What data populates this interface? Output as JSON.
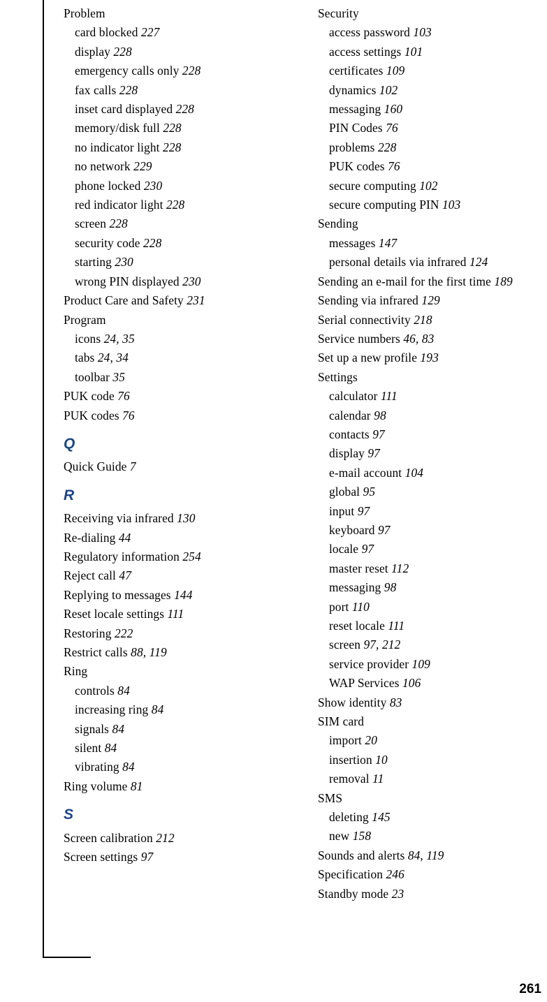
{
  "page": {
    "folio": "261",
    "rule_color": "#000000",
    "section_letter_color": "#1c4587"
  },
  "columns": {
    "left": [
      {
        "kind": "entry",
        "level": 1,
        "text": "Problem",
        "pages": ""
      },
      {
        "kind": "entry",
        "level": 2,
        "text": "card blocked",
        "pages": "227"
      },
      {
        "kind": "entry",
        "level": 2,
        "text": "display",
        "pages": "228"
      },
      {
        "kind": "entry",
        "level": 2,
        "text": "emergency calls only",
        "pages": "228"
      },
      {
        "kind": "entry",
        "level": 2,
        "text": "fax calls",
        "pages": "228"
      },
      {
        "kind": "entry",
        "level": 2,
        "text": "inset card displayed",
        "pages": "228"
      },
      {
        "kind": "entry",
        "level": 2,
        "text": "memory/disk full",
        "pages": "228"
      },
      {
        "kind": "entry",
        "level": 2,
        "text": "no indicator light",
        "pages": "228"
      },
      {
        "kind": "entry",
        "level": 2,
        "text": "no network",
        "pages": "229"
      },
      {
        "kind": "entry",
        "level": 2,
        "text": "phone locked",
        "pages": "230"
      },
      {
        "kind": "entry",
        "level": 2,
        "text": "red indicator light",
        "pages": "228"
      },
      {
        "kind": "entry",
        "level": 2,
        "text": "screen",
        "pages": "228"
      },
      {
        "kind": "entry",
        "level": 2,
        "text": "security code",
        "pages": "228"
      },
      {
        "kind": "entry",
        "level": 2,
        "text": "starting",
        "pages": "230"
      },
      {
        "kind": "entry",
        "level": 2,
        "text": "wrong PIN displayed",
        "pages": "230"
      },
      {
        "kind": "entry",
        "level": 1,
        "text": "Product Care and Safety",
        "pages": "231"
      },
      {
        "kind": "entry",
        "level": 1,
        "text": "Program",
        "pages": ""
      },
      {
        "kind": "entry",
        "level": 2,
        "text": "icons",
        "pages": "24, 35"
      },
      {
        "kind": "entry",
        "level": 2,
        "text": "tabs",
        "pages": "24, 34"
      },
      {
        "kind": "entry",
        "level": 2,
        "text": "toolbar",
        "pages": "35"
      },
      {
        "kind": "entry",
        "level": 1,
        "text": "PUK code",
        "pages": "76"
      },
      {
        "kind": "entry",
        "level": 1,
        "text": "PUK codes",
        "pages": "76"
      },
      {
        "kind": "letter",
        "letter": "Q"
      },
      {
        "kind": "entry",
        "level": 1,
        "text": "Quick Guide",
        "pages": "7"
      },
      {
        "kind": "letter",
        "letter": "R"
      },
      {
        "kind": "entry",
        "level": 1,
        "text": "Receiving via infrared",
        "pages": "130"
      },
      {
        "kind": "entry",
        "level": 1,
        "text": "Re-dialing",
        "pages": "44"
      },
      {
        "kind": "entry",
        "level": 1,
        "text": "Regulatory information",
        "pages": "254"
      },
      {
        "kind": "entry",
        "level": 1,
        "text": "Reject call",
        "pages": "47"
      },
      {
        "kind": "entry",
        "level": 1,
        "text": "Replying to messages",
        "pages": "144"
      },
      {
        "kind": "entry",
        "level": 1,
        "text": "Reset locale settings",
        "pages": "111"
      },
      {
        "kind": "entry",
        "level": 1,
        "text": "Restoring",
        "pages": "222"
      },
      {
        "kind": "entry",
        "level": 1,
        "text": "Restrict calls",
        "pages": "88, 119"
      },
      {
        "kind": "entry",
        "level": 1,
        "text": "Ring",
        "pages": ""
      },
      {
        "kind": "entry",
        "level": 2,
        "text": "controls",
        "pages": "84"
      },
      {
        "kind": "entry",
        "level": 2,
        "text": "increasing ring",
        "pages": "84"
      },
      {
        "kind": "entry",
        "level": 2,
        "text": "signals",
        "pages": "84"
      },
      {
        "kind": "entry",
        "level": 2,
        "text": "silent",
        "pages": "84"
      },
      {
        "kind": "entry",
        "level": 2,
        "text": "vibrating",
        "pages": "84"
      },
      {
        "kind": "entry",
        "level": 1,
        "text": "Ring volume",
        "pages": "81"
      },
      {
        "kind": "letter",
        "letter": "S"
      },
      {
        "kind": "entry",
        "level": 1,
        "text": "Screen calibration",
        "pages": "212"
      },
      {
        "kind": "entry",
        "level": 1,
        "text": "Screen settings",
        "pages": "97"
      }
    ],
    "right": [
      {
        "kind": "entry",
        "level": 1,
        "text": "Security",
        "pages": ""
      },
      {
        "kind": "entry",
        "level": 2,
        "text": "access password",
        "pages": "103"
      },
      {
        "kind": "entry",
        "level": 2,
        "text": "access settings",
        "pages": "101"
      },
      {
        "kind": "entry",
        "level": 2,
        "text": "certificates",
        "pages": "109"
      },
      {
        "kind": "entry",
        "level": 2,
        "text": "dynamics",
        "pages": "102"
      },
      {
        "kind": "entry",
        "level": 2,
        "text": "messaging",
        "pages": "160"
      },
      {
        "kind": "entry",
        "level": 2,
        "text": "PIN Codes",
        "pages": "76"
      },
      {
        "kind": "entry",
        "level": 2,
        "text": "problems",
        "pages": "228"
      },
      {
        "kind": "entry",
        "level": 2,
        "text": "PUK codes",
        "pages": "76"
      },
      {
        "kind": "entry",
        "level": 2,
        "text": "secure computing",
        "pages": "102"
      },
      {
        "kind": "entry",
        "level": 2,
        "text": "secure computing PIN",
        "pages": "103"
      },
      {
        "kind": "entry",
        "level": 1,
        "text": "Sending",
        "pages": ""
      },
      {
        "kind": "entry",
        "level": 2,
        "text": "messages",
        "pages": "147"
      },
      {
        "kind": "entry",
        "level": 2,
        "text": "personal details via infrared",
        "pages": "124"
      },
      {
        "kind": "entry",
        "level": 1,
        "text": "Sending an e-mail for the first time",
        "pages": "189"
      },
      {
        "kind": "entry",
        "level": 1,
        "text": "Sending via infrared",
        "pages": "129"
      },
      {
        "kind": "entry",
        "level": 1,
        "text": "Serial connectivity",
        "pages": "218"
      },
      {
        "kind": "entry",
        "level": 1,
        "text": "Service numbers",
        "pages": "46, 83"
      },
      {
        "kind": "entry",
        "level": 1,
        "text": "Set up a new profile",
        "pages": "193"
      },
      {
        "kind": "entry",
        "level": 1,
        "text": "Settings",
        "pages": ""
      },
      {
        "kind": "entry",
        "level": 2,
        "text": "calculator",
        "pages": "111"
      },
      {
        "kind": "entry",
        "level": 2,
        "text": "calendar",
        "pages": "98"
      },
      {
        "kind": "entry",
        "level": 2,
        "text": "contacts",
        "pages": "97"
      },
      {
        "kind": "entry",
        "level": 2,
        "text": "display",
        "pages": "97"
      },
      {
        "kind": "entry",
        "level": 2,
        "text": "e-mail account",
        "pages": "104"
      },
      {
        "kind": "entry",
        "level": 2,
        "text": "global",
        "pages": "95"
      },
      {
        "kind": "entry",
        "level": 2,
        "text": "input",
        "pages": "97"
      },
      {
        "kind": "entry",
        "level": 2,
        "text": "keyboard",
        "pages": "97"
      },
      {
        "kind": "entry",
        "level": 2,
        "text": "locale",
        "pages": "97"
      },
      {
        "kind": "entry",
        "level": 2,
        "text": "master reset",
        "pages": "112"
      },
      {
        "kind": "entry",
        "level": 2,
        "text": "messaging",
        "pages": "98"
      },
      {
        "kind": "entry",
        "level": 2,
        "text": "port",
        "pages": "110"
      },
      {
        "kind": "entry",
        "level": 2,
        "text": "reset locale",
        "pages": "111"
      },
      {
        "kind": "entry",
        "level": 2,
        "text": "screen",
        "pages": "97, 212"
      },
      {
        "kind": "entry",
        "level": 2,
        "text": "service provider",
        "pages": "109"
      },
      {
        "kind": "entry",
        "level": 2,
        "text": "WAP Services",
        "pages": "106"
      },
      {
        "kind": "entry",
        "level": 1,
        "text": "Show identity",
        "pages": "83"
      },
      {
        "kind": "entry",
        "level": 1,
        "text": "SIM card",
        "pages": ""
      },
      {
        "kind": "entry",
        "level": 2,
        "text": "import",
        "pages": "20"
      },
      {
        "kind": "entry",
        "level": 2,
        "text": "insertion",
        "pages": "10"
      },
      {
        "kind": "entry",
        "level": 2,
        "text": "removal",
        "pages": "11"
      },
      {
        "kind": "entry",
        "level": 1,
        "text": "SMS",
        "pages": ""
      },
      {
        "kind": "entry",
        "level": 2,
        "text": "deleting",
        "pages": "145"
      },
      {
        "kind": "entry",
        "level": 2,
        "text": "new",
        "pages": "158"
      },
      {
        "kind": "entry",
        "level": 1,
        "text": "Sounds and alerts",
        "pages": "84, 119"
      },
      {
        "kind": "entry",
        "level": 1,
        "text": "Specification",
        "pages": "246"
      },
      {
        "kind": "entry",
        "level": 1,
        "text": "Standby mode",
        "pages": "23"
      }
    ]
  }
}
